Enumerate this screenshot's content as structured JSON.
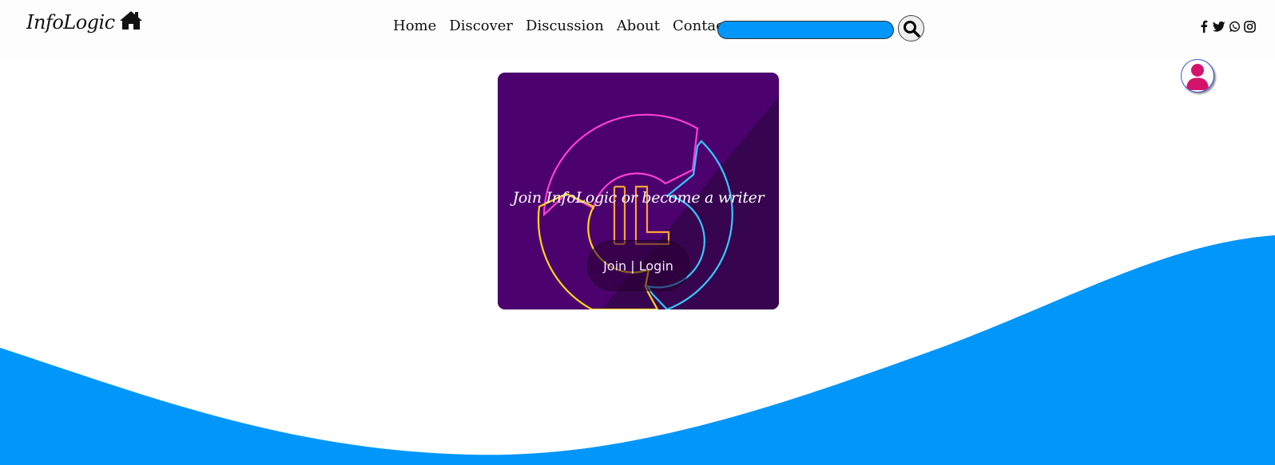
{
  "header": {
    "brand": "InfoLogic",
    "brand_icon": "home-icon",
    "nav": [
      "Home",
      "Discover",
      "Discussion",
      "About",
      "Contact"
    ],
    "search": {
      "placeholder": "",
      "value": "",
      "button_icon": "search-icon",
      "field_color": "#0096fa"
    },
    "socials": [
      "facebook-icon",
      "twitter-icon",
      "whatsapp-icon",
      "instagram-icon"
    ]
  },
  "user": {
    "avatar_icon": "user-icon",
    "avatar_color": "#d4136c"
  },
  "hero": {
    "title": "Join InfoLogic or become a writer",
    "button_label": "Join | Login",
    "logo_text": "IL",
    "background": "#4c026e"
  },
  "colors": {
    "accent": "#0096fa",
    "brand_purple": "#4c026e",
    "avatar_pink": "#d4136c"
  }
}
